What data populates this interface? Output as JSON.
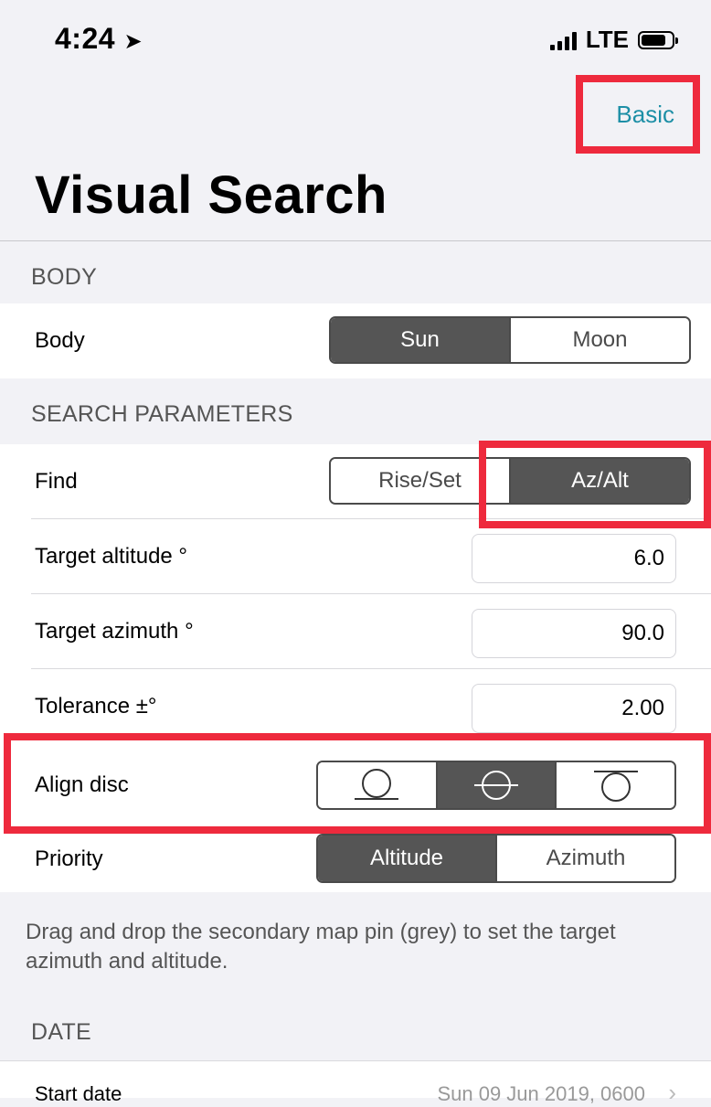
{
  "status": {
    "time": "4:24",
    "network": "LTE"
  },
  "nav": {
    "right_link": "Basic",
    "title": "Visual Search"
  },
  "sections": {
    "body": "BODY",
    "search": "SEARCH PARAMETERS",
    "date": "DATE"
  },
  "body_row": {
    "label": "Body",
    "options": [
      "Sun",
      "Moon"
    ],
    "selected": "Sun"
  },
  "find_row": {
    "label": "Find",
    "options": [
      "Rise/Set",
      "Az/Alt"
    ],
    "selected": "Az/Alt"
  },
  "target_altitude": {
    "label": "Target altitude °",
    "value": "6.0"
  },
  "target_azimuth": {
    "label": "Target azimuth °",
    "value": "90.0"
  },
  "tolerance": {
    "label": "Tolerance ±°",
    "value": "2.00"
  },
  "align_disc": {
    "label": "Align disc",
    "options": [
      "disc-bottom-icon",
      "disc-center-icon",
      "disc-top-icon"
    ],
    "selected": "disc-center-icon"
  },
  "priority": {
    "label": "Priority",
    "options": [
      "Altitude",
      "Azimuth"
    ],
    "selected": "Altitude"
  },
  "footnote": "Drag and drop the secondary map pin (grey) to set the target azimuth and altitude.",
  "start_date": {
    "label": "Start date",
    "value": "Sun 09 Jun 2019, 0600"
  },
  "colors": {
    "accent": "#1d8fa6",
    "highlight": "#ee2a3d",
    "selected_segment": "#555555"
  }
}
